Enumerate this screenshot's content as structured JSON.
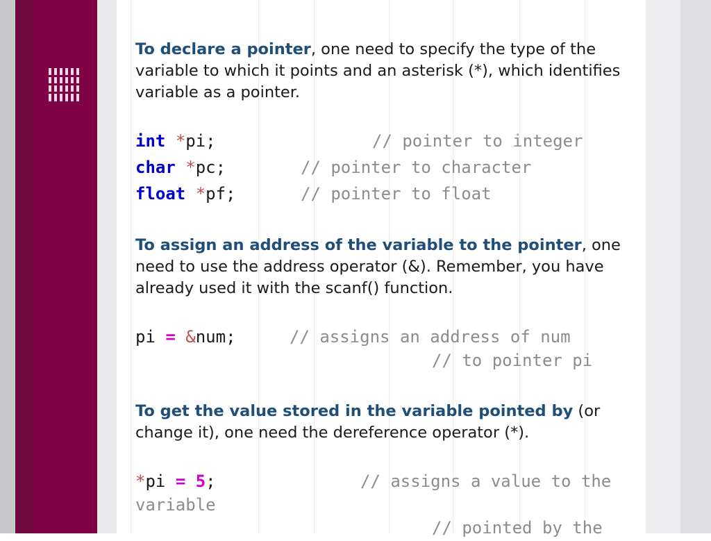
{
  "paragraphs": {
    "declare": {
      "highlight": "To declare a pointer",
      "line1_rest": ", one need to specify the type of the",
      "line2": "variable to which it points and an asterisk (*), which identifies",
      "line3": "variable as a pointer."
    },
    "assign": {
      "highlight": "To assign an address of the variable to the pointer",
      "line1_rest": ", one",
      "line2": "need to use the address operator (&). Remember, you have",
      "line3": "already used it with the scanf() function."
    },
    "get_value": {
      "highlight": "To get the value stored in the variable pointed by",
      "line1_rest": " (or",
      "line2": "change it), one need the dereference operator (*)."
    }
  },
  "code": {
    "decl_int": {
      "keyword": "int",
      "star": "*",
      "name": "pi;",
      "comment": "// pointer to integer"
    },
    "decl_char": {
      "keyword": "char",
      "star": "*",
      "name": "pc;",
      "comment": "// pointer to character"
    },
    "decl_float": {
      "keyword": "float",
      "star": "*",
      "name": "pf;",
      "comment": "// pointer to float"
    },
    "assign_line": {
      "lhs": "pi",
      "eq": "=",
      "amp": "&",
      "rhs": "num;",
      "comment1": "// assigns an address of num",
      "comment2": "// to pointer pi"
    },
    "deref_line": {
      "star": "*",
      "lhs": "pi",
      "eq": "=",
      "value": "5",
      "semi": ";",
      "comment1": "// assigns a value to the",
      "comment1_wrap": "variable",
      "comment2": "// pointed by the"
    }
  },
  "colors": {
    "maroon": "#800046",
    "heading_blue": "#1f4e79",
    "keyword_blue": "#0000cc",
    "comment_gray": "#8c8c8c",
    "operator_red": "#c0504d",
    "operator_magenta": "#d000c8"
  }
}
